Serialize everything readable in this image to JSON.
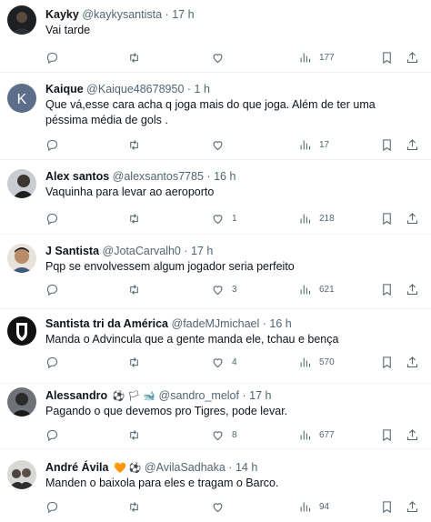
{
  "tweets": [
    {
      "name": "Kayky",
      "handle": "@kaykysantista",
      "time": "17 h",
      "badge": "",
      "text": "Vai tarde",
      "likes": "",
      "views": "177",
      "avatar": "dark"
    },
    {
      "name": "Kaique",
      "handle": "@Kaique48678950",
      "time": "1 h",
      "badge": "",
      "text": "Que vá,esse cara acha q joga mais do que joga. Além de ter uma péssima média de gols .",
      "likes": "",
      "views": "17",
      "avatar": "letter",
      "avatar_letter": "K"
    },
    {
      "name": "Alex santos",
      "handle": "@alexsantos7785",
      "time": "16 h",
      "badge": "",
      "text": "Vaquinha para levar ao aeroporto",
      "likes": "1",
      "views": "218",
      "avatar": "photo"
    },
    {
      "name": "J Santista",
      "handle": "@JotaCarvalh0",
      "time": "17 h",
      "badge": "",
      "text": "Pqp se envolvessem algum jogador seria perfeito",
      "likes": "3",
      "views": "621",
      "avatar": "face"
    },
    {
      "name": "Santista tri da América",
      "handle": "@fadeMJmichael",
      "time": "16 h",
      "badge": "",
      "text": "Manda o Advincula que a gente manda ele, tchau e bença",
      "likes": "4",
      "views": "570",
      "avatar": "crest"
    },
    {
      "name": "Alessandro",
      "handle": "@sandro_melof",
      "time": "17 h",
      "badge": "⚽ 🏳 🐋",
      "text": "Pagando o que devemos pro Tigres, pode levar.",
      "likes": "8",
      "views": "677",
      "avatar": "dark"
    },
    {
      "name": "André Ávila",
      "handle": "@AvilaSadhaka",
      "time": "14 h",
      "badge": "🧡 ⚽",
      "text": "Manden o baixola para eles e tragam o Barco.",
      "likes": "",
      "views": "94",
      "avatar": "group"
    }
  ],
  "colors": {
    "text": "#0f1419",
    "muted": "#536471",
    "divider": "#eff3f4",
    "letter_avatar": "#5c6e8a"
  },
  "icons": [
    "reply-icon",
    "retweet-icon",
    "like-icon",
    "views-icon",
    "bookmark-icon",
    "share-icon"
  ]
}
